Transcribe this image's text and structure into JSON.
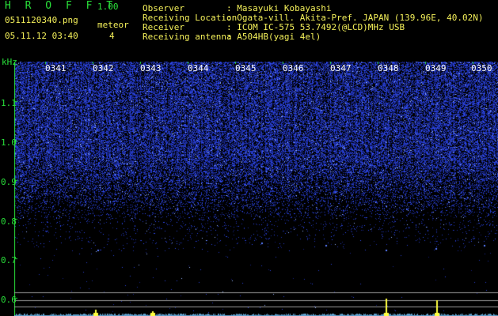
{
  "header": {
    "app_name": "H R O F F T",
    "app_version": "1.00",
    "filename": "0511120340.png",
    "datetime": "05.11.12 03:40",
    "meteor_label": "meteor",
    "meteor_count": "4"
  },
  "info": [
    {
      "label": "Observer",
      "value": ": Masayuki Kobayashi"
    },
    {
      "label": "Receiving Location",
      "value": ": Ogata-vill. Akita-Pref. JAPAN (139.96E, 40.02N)"
    },
    {
      "label": "Receiver",
      "value": ": ICOM IC-575 53.7492(@LCD)MHz USB"
    },
    {
      "label": "Receiving antenna",
      "value": ": A504HB(yagi 4el)"
    }
  ],
  "spectrogram": {
    "y_unit": "kHz",
    "y_ticks": [
      "1.1",
      "1.0",
      "0.9",
      "0.8",
      "0.7",
      "0.6"
    ],
    "x_ticks": [
      "0341",
      "0342",
      "0343",
      "0344",
      "0345",
      "0346",
      "0347",
      "0348",
      "0349",
      "0350"
    ],
    "colors": {
      "noise": "#2a3cff",
      "tick_green": "#29e03a",
      "ref_line": "#9a9a9a",
      "event": "#ffff40"
    }
  }
}
